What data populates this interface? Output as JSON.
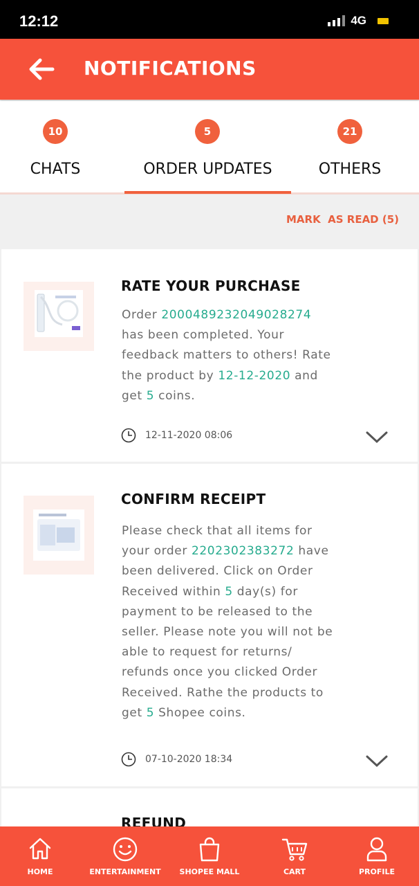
{
  "status_bar": {
    "time": "12:12",
    "network": "4G"
  },
  "header": {
    "title": "NOTIFICATIONS"
  },
  "tabs": [
    {
      "label": "CHATS",
      "count": "10"
    },
    {
      "label": "ORDER UPDATES",
      "count": "5",
      "active": true
    },
    {
      "label": "OTHERS",
      "count": "21"
    }
  ],
  "mark_as_read": "MARK  AS READ (5)",
  "notifications": [
    {
      "title": "RATE YOUR PURCHASE",
      "body": {
        "t1": "Order ",
        "order_id": "2000489232049028274",
        "t2": " has been completed. Your feedback matters to others! Rate the product by ",
        "date": "12-12-2020",
        "t3": " and get ",
        "coins": "5",
        "t4": " coins."
      },
      "timestamp": "12-11-2020 08:06"
    },
    {
      "title": "CONFIRM RECEIPT",
      "body": {
        "t1": "Please check that all items for your order ",
        "order_id": "2202302383272",
        "t2": " have been delivered. Click on Order Received within ",
        "days": "5",
        "t3": " day(s) for payment to be released to the seller. Please note you will not be able to request for returns/ refunds once you clicked Order Received. Rathe the products to get ",
        "coins": "5",
        "t4": " Shopee coins."
      },
      "timestamp": "07-10-2020 18:34"
    },
    {
      "title": "REFUND"
    }
  ],
  "bottom_nav": [
    {
      "label": "HOME",
      "icon": "home-icon"
    },
    {
      "label": "ENTERTAINMENT",
      "icon": "smiley-icon"
    },
    {
      "label": "SHOPEE MALL",
      "icon": "shopping-bag-icon"
    },
    {
      "label": "CART",
      "icon": "cart-icon"
    },
    {
      "label": "PROFILE",
      "icon": "profile-icon"
    }
  ],
  "colors": {
    "brand": "#f6523b",
    "highlight": "#26ab8e",
    "badge": "#f0613d"
  }
}
